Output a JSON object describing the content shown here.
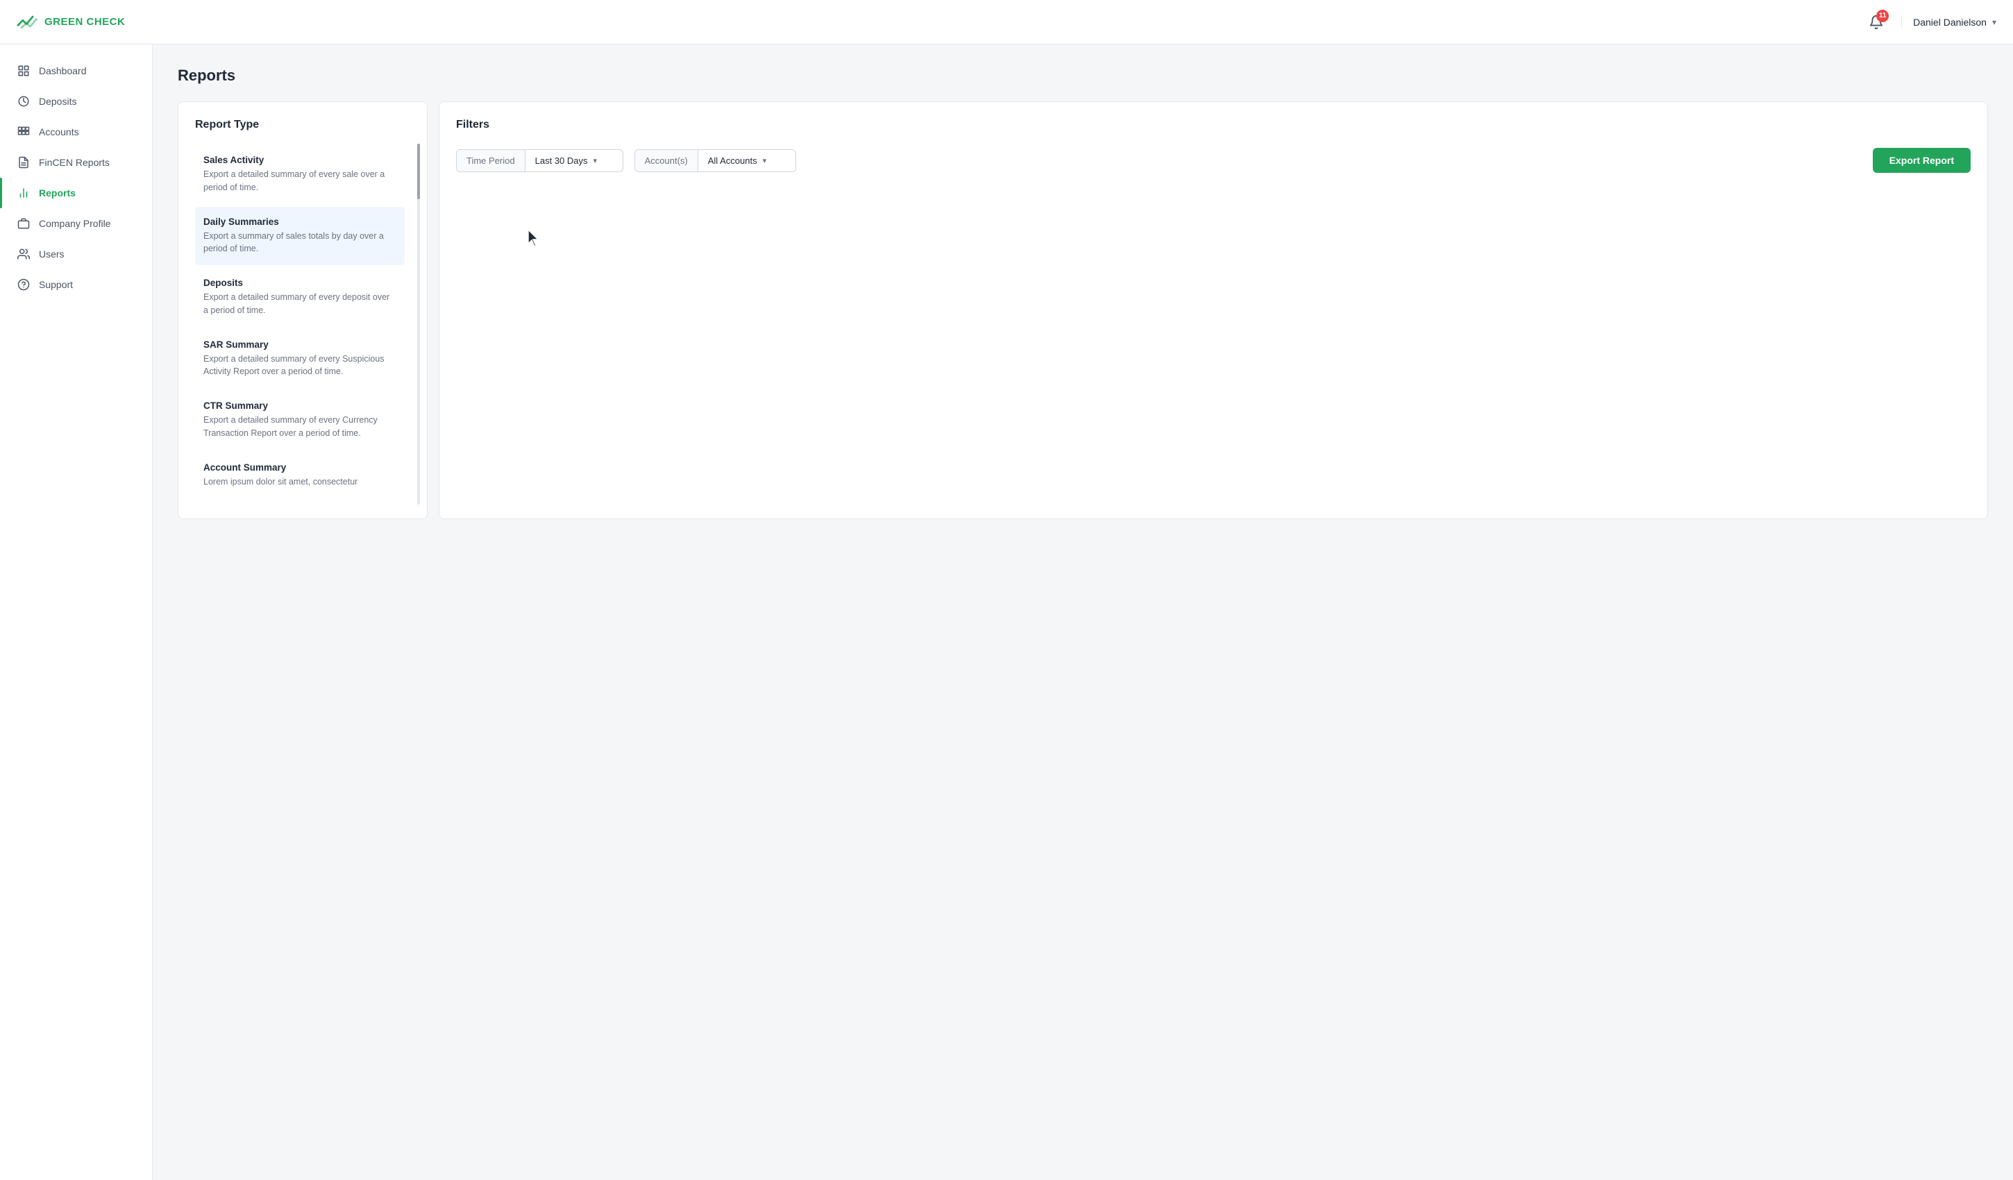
{
  "app": {
    "name": "GREEN CHECK",
    "logo_alt": "Green Check Logo"
  },
  "header": {
    "notification_count": "11",
    "user_name": "Daniel Danielson",
    "chevron": "▾"
  },
  "sidebar": {
    "items": [
      {
        "id": "dashboard",
        "label": "Dashboard",
        "icon": "dashboard-icon",
        "active": false
      },
      {
        "id": "deposits",
        "label": "Deposits",
        "icon": "deposits-icon",
        "active": false
      },
      {
        "id": "accounts",
        "label": "Accounts",
        "icon": "accounts-icon",
        "active": false
      },
      {
        "id": "fincen-reports",
        "label": "FinCEN Reports",
        "icon": "fincen-icon",
        "active": false
      },
      {
        "id": "reports",
        "label": "Reports",
        "icon": "reports-icon",
        "active": true
      },
      {
        "id": "company-profile",
        "label": "Company Profile",
        "icon": "company-icon",
        "active": false
      },
      {
        "id": "users",
        "label": "Users",
        "icon": "users-icon",
        "active": false
      },
      {
        "id": "support",
        "label": "Support",
        "icon": "support-icon",
        "active": false
      }
    ]
  },
  "page": {
    "title": "Reports"
  },
  "report_type_panel": {
    "title": "Report Type",
    "items": [
      {
        "id": "sales-activity",
        "title": "Sales Activity",
        "description": "Export a detailed summary of every sale over a period of time.",
        "selected": false
      },
      {
        "id": "daily-summaries",
        "title": "Daily Summaries",
        "description": "Export a summary of sales totals by day over a period of time.",
        "selected": true
      },
      {
        "id": "deposits",
        "title": "Deposits",
        "description": "Export a detailed summary of every deposit over a period of time.",
        "selected": false
      },
      {
        "id": "sar-summary",
        "title": "SAR Summary",
        "description": "Export a detailed summary of every Suspicious Activity Report over a period of time.",
        "selected": false
      },
      {
        "id": "ctr-summary",
        "title": "CTR Summary",
        "description": "Export a detailed summary of every Currency Transaction Report over a period of time.",
        "selected": false
      },
      {
        "id": "account-summary",
        "title": "Account Summary",
        "description": "Lorem ipsum dolor sit amet, consectetur adipiscing elit.",
        "selected": false
      }
    ]
  },
  "filters_panel": {
    "title": "Filters",
    "time_period_label": "Time Period",
    "time_period_value": "Last 30 Days",
    "accounts_label": "Account(s)",
    "accounts_value": "All Accounts",
    "export_button_label": "Export Report"
  }
}
